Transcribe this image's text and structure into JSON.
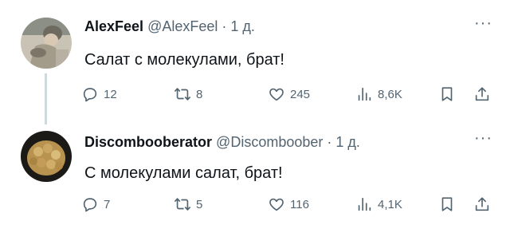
{
  "tweets": [
    {
      "name": "AlexFeel",
      "handle": "@AlexFeel",
      "separator": "·",
      "time": "1 д.",
      "text": "Салат с молекулами, брат!",
      "replies": "12",
      "retweets": "8",
      "likes": "245",
      "views": "8,6K",
      "more": "···"
    },
    {
      "name": "Discombooberator",
      "handle": "@Discomboober",
      "separator": "·",
      "time": "1 д.",
      "text": "С молекулами салат, брат!",
      "replies": "7",
      "retweets": "5",
      "likes": "116",
      "views": "4,1K",
      "more": "···"
    }
  ],
  "colors": {
    "text": "#0f1419",
    "secondary": "#536471",
    "thread_line": "#cfd9de"
  },
  "icons": [
    "reply-icon",
    "retweet-icon",
    "like-icon",
    "views-icon",
    "bookmark-icon",
    "share-icon",
    "more-icon"
  ]
}
